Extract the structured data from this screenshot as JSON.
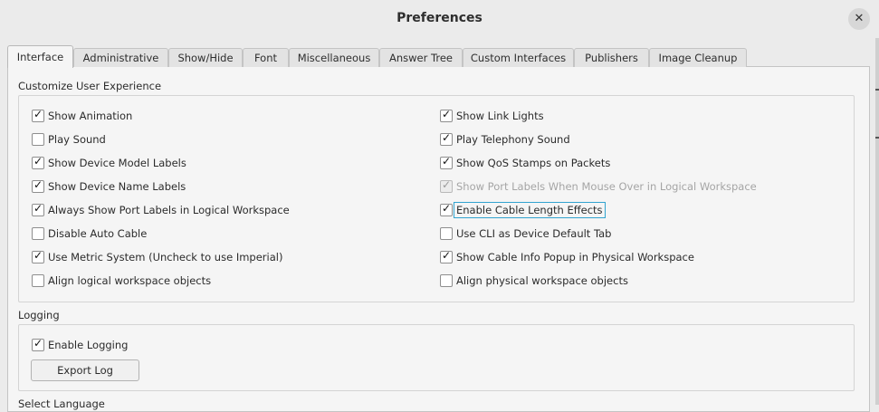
{
  "window": {
    "title": "Preferences"
  },
  "tabs": [
    "Interface",
    "Administrative",
    "Show/Hide",
    "Font",
    "Miscellaneous",
    "Answer Tree",
    "Custom Interfaces",
    "Publishers",
    "Image Cleanup"
  ],
  "customize": {
    "title": "Customize User Experience",
    "left": [
      {
        "label": "Show Animation",
        "checked": true
      },
      {
        "label": "Play Sound",
        "checked": false
      },
      {
        "label": "Show Device Model Labels",
        "checked": true
      },
      {
        "label": "Show Device Name Labels",
        "checked": true
      },
      {
        "label": "Always Show Port Labels in Logical Workspace",
        "checked": true
      },
      {
        "label": "Disable Auto Cable",
        "checked": false
      },
      {
        "label": "Use Metric System (Uncheck to use Imperial)",
        "checked": true
      },
      {
        "label": "Align logical workspace objects",
        "checked": false
      }
    ],
    "right": [
      {
        "label": "Show Link Lights",
        "checked": true
      },
      {
        "label": "Play Telephony Sound",
        "checked": true
      },
      {
        "label": "Show QoS Stamps on Packets",
        "checked": true
      },
      {
        "label": "Show Port Labels When Mouse Over in Logical Workspace",
        "checked": true,
        "disabled": true
      },
      {
        "label": "Enable Cable Length Effects",
        "checked": true,
        "focused": true
      },
      {
        "label": "Use CLI as Device Default Tab",
        "checked": false
      },
      {
        "label": "Show Cable Info Popup in Physical Workspace",
        "checked": true
      },
      {
        "label": "Align physical workspace objects",
        "checked": false
      }
    ]
  },
  "logging": {
    "title": "Logging",
    "enable_label": "Enable Logging",
    "enable_checked": true,
    "export_label": "Export Log"
  },
  "language": {
    "title": "Select Language"
  },
  "icons": {
    "close": "close-icon",
    "check": "check-icon"
  }
}
